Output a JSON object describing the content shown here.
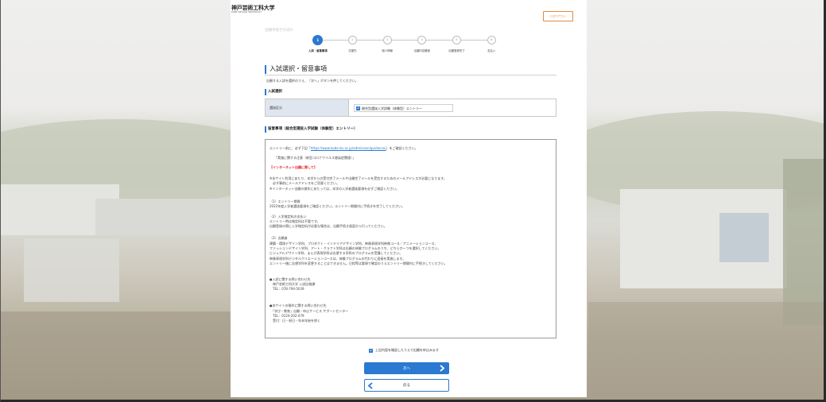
{
  "header": {
    "logo_jp": "神戸芸術工科大学",
    "logo_en": "KOBE DESIGN UNIVERSITY",
    "logout_label": "ログアウト"
  },
  "flow_label": "出願手続きの流れ",
  "current_step": 1,
  "steps": [
    {
      "number": "1",
      "label": "入試・留意事項"
    },
    {
      "number": "2",
      "label": "志望先"
    },
    {
      "number": "3",
      "label": "個人情報"
    },
    {
      "number": "4",
      "label": "出願内容確認"
    },
    {
      "number": "5",
      "label": "出願登録完了"
    },
    {
      "number": "6",
      "label": "支払い"
    }
  ],
  "page_title": "入試選択・留意事項",
  "page_instruction": "出願する入試を選択のうえ、「次へ」ボタンを押してください。",
  "exam_section": {
    "heading": "入試選択",
    "row_label": "選抜区分",
    "option_label": "総合型選抜入学試験（体験型）エントリー",
    "checked": true
  },
  "notes_section": {
    "heading": "留意事項（総合型選抜入学試験（体験型）エントリー）",
    "intro": {
      "before": "エントリー前に、必ず下記「",
      "link": "https://www.kobe-du.ac.jp/admission/guidance/",
      "after": "」をご確認ください。"
    },
    "lines": [
      "「実施に関する注意（新型コロナウイルス感染症関連）」",
      "【インターネット出願に際して】",
      "※本サイト利用にあたり、本学からの受付完了メールや出願完了メールを受信するためのメールアドレスが必要になります。",
      "　必ず事前にメールアドレスをご用意ください。",
      "※インターネット出願の操作にあたっては、本学の入学者選抜要項を必ずご確認ください。",
      "（1）エントリー期間",
      "2022年度入学者選抜要項をご確認ください。エントリー期間内に手続きを完了してください。",
      "（2）入学検定料の支払い",
      "エントリー時は検定料は不要です。",
      "出願登録の際に入学検定料が必要な場合は、出願手続き画面から行ってください。",
      "（3）志願者",
      "建築・環境デザイン学科、プロダクト・インテリアデザイン学科、映像表現学科映像コース／アニメーションコース、",
      "ファッションデザイン学科、アート・クラフト学科は出願の体験プログラムのうち、どちらか一つを選択してください。",
      "ビジュアルデザイン学科、まんが表現学科は志望する学科のプログラムを受講してください。",
      "映像表現学科デジタルクリエーションコースは、体験プログラムの代わりに面接を実施します。",
      "エントリー後に志望学科を変更することはできません。日程等は要項で確認のうえエントリー期間内に手続きしてください。",
      "●入試に関する問い合わせ先",
      "　神戸芸術工科大学 入試広報課",
      "　TEL：078-794-5039",
      "●本サイトの操作に関する問い合わせ先",
      "　「学び・教育」出願・申込サービス サポートセンター",
      "　TEL：0120-202-079",
      "　受付：日・祝日・年末年始を除く"
    ]
  },
  "confirm": {
    "label": "上記内容を確認したうえで出願を申込みます",
    "checked": true
  },
  "buttons": {
    "next": "次へ",
    "back": "戻る"
  },
  "icons": {
    "next": "chevron-right-icon",
    "back": "chevron-left-icon",
    "checkbox": "check-icon"
  },
  "colors": {
    "accent": "#2b79d0",
    "warning": "#e0262a",
    "logout": "#e8883a",
    "label_cell": "#dfe6ef"
  }
}
